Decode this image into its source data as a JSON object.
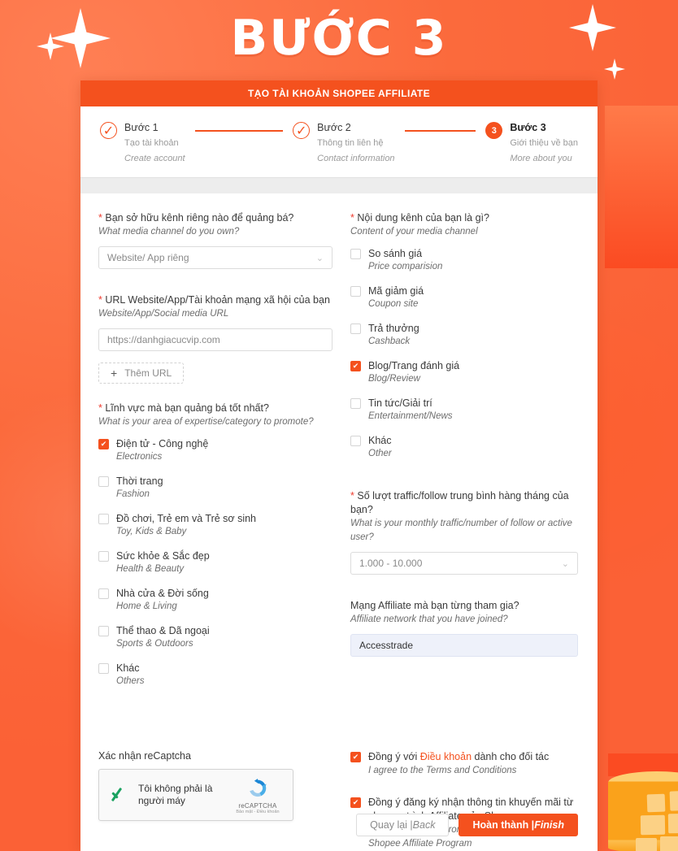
{
  "hero": {
    "title": "BƯỚC 3"
  },
  "card": {
    "header_title": "TẠO TÀI KHOẢN SHOPEE AFFILIATE"
  },
  "stepper": {
    "steps": [
      {
        "marker": "✓",
        "state": "done",
        "title": "Bước 1",
        "sub_vi": "Tạo tài khoản",
        "sub_en": "Create account"
      },
      {
        "marker": "✓",
        "state": "done",
        "title": "Bước 2",
        "sub_vi": "Thông tin liên hệ",
        "sub_en": "Contact information"
      },
      {
        "marker": "3",
        "state": "current",
        "title": "Bước 3",
        "sub_vi": "Giới thiệu về bạn",
        "sub_en": "More about you"
      }
    ]
  },
  "left": {
    "media_channel": {
      "label_vi": "Bạn sở hữu kênh riêng nào để quảng bá?",
      "label_en": "What media channel do you own?",
      "required": true,
      "value": "Website/ App riêng",
      "chevron": "chevron-down-icon"
    },
    "url_field": {
      "label_vi": "URL Website/App/Tài khoản mạng xã hội của bạn",
      "label_en": "Website/App/Social media URL",
      "required": true,
      "value": "https://danhgiacucvip.com"
    },
    "add_url_button": {
      "plus": "+",
      "label": "Thêm URL"
    },
    "expertise": {
      "label_vi": "Lĩnh vực mà bạn quảng bá tốt nhất?",
      "label_en": "What is your area of expertise/category to promote?",
      "required": true,
      "options": [
        {
          "vi": "Điện tử - Công nghệ",
          "en": "Electronics",
          "checked": true
        },
        {
          "vi": "Thời trang",
          "en": "Fashion",
          "checked": false
        },
        {
          "vi": "Đồ chơi, Trẻ em và Trẻ sơ sinh",
          "en": "Toy, Kids & Baby",
          "checked": false
        },
        {
          "vi": "Sức khỏe & Sắc đẹp",
          "en": "Health & Beauty",
          "checked": false
        },
        {
          "vi": "Nhà cửa & Đời sống",
          "en": "Home & Living",
          "checked": false
        },
        {
          "vi": "Thể thao & Dã ngoại",
          "en": "Sports & Outdoors",
          "checked": false
        },
        {
          "vi": "Khác",
          "en": "Others",
          "checked": false
        }
      ]
    }
  },
  "right": {
    "content_channel": {
      "label_vi": "Nội dung kênh của bạn là gì?",
      "label_en": "Content of your media channel",
      "required": true,
      "options": [
        {
          "vi": "So sánh giá",
          "en": "Price comparision",
          "checked": false
        },
        {
          "vi": "Mã giảm giá",
          "en": "Coupon site",
          "checked": false
        },
        {
          "vi": "Trả thưởng",
          "en": "Cashback",
          "checked": false
        },
        {
          "vi": "Blog/Trang đánh giá",
          "en": "Blog/Review",
          "checked": true
        },
        {
          "vi": "Tin tức/Giải trí",
          "en": "Entertainment/News",
          "checked": false
        },
        {
          "vi": "Khác",
          "en": "Other",
          "checked": false
        }
      ]
    },
    "traffic": {
      "label_vi": "Số lượt traffic/follow trung bình hàng tháng của bạn?",
      "label_en": "What is your monthly traffic/number of follow or active user?",
      "required": true,
      "value": "1.000 - 10.000",
      "chevron": "chevron-down-icon"
    },
    "network": {
      "label_vi": "Mạng Affiliate mà bạn từng tham gia?",
      "label_en": "Affiliate network that you have joined?",
      "required": false,
      "value": "Accesstrade"
    }
  },
  "captcha": {
    "label": "Xác nhận reCaptcha",
    "checkbox_text": "Tôi không phải là người máy",
    "brand": "reCAPTCHA",
    "legal": "Bảo mật - Điều khoản",
    "checked": true
  },
  "agreements": [
    {
      "checked": true,
      "vi_before": "Đồng ý với ",
      "vi_link": "Điều khoản",
      "vi_after": " dành cho đối tác",
      "en": "I agree to the Terms and Conditions"
    },
    {
      "checked": true,
      "vi_before": "Đồng ý đăng ký nhận thông tin khuyến mãi từ chương trình Affiliate của Shopee",
      "vi_link": "",
      "vi_after": "",
      "en": "I agree to receive promotion information from Shopee Affiliate Program"
    }
  ],
  "buttons": {
    "back_vi": "Quay lại |",
    "back_en": "Back",
    "finish_vi": "Hoàn thành |",
    "finish_en": "Finish"
  },
  "colors": {
    "brand_orange": "#f4511e",
    "bg_orange": "#fb6a3c",
    "header_bar": "#f4511e",
    "link": "#f4511e",
    "captcha_green": "#1aa260",
    "filled_input_bg": "#eef1fa"
  }
}
